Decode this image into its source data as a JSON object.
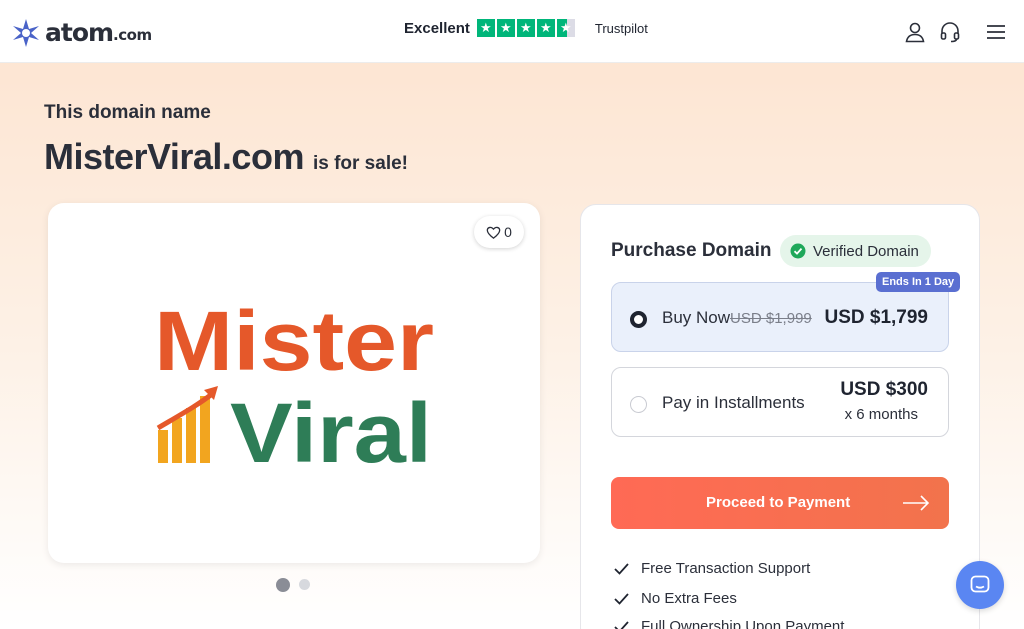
{
  "header": {
    "brand": "atom",
    "brand_tld": ".com",
    "trust_label": "Excellent",
    "trust_brand": "Trustpilot",
    "rating_stars": 4.5,
    "icons": [
      "user-icon",
      "headset-icon",
      "menu-icon"
    ]
  },
  "hero": {
    "subtitle": "This domain name",
    "domain": "MisterViral.com",
    "for_sale": "is for sale!"
  },
  "gallery": {
    "like_count": "0",
    "logo_line1": "Mister",
    "logo_line2": "Viral",
    "active_slide": 1,
    "slide_count": 2
  },
  "purchase": {
    "title": "Purchase Domain",
    "verified": "Verified Domain",
    "badge": "Ends In 1 Day",
    "options": [
      {
        "label": "Buy Now",
        "old_price": "USD $1,999",
        "price": "USD $1,799",
        "selected": true
      },
      {
        "label": "Pay in Installments",
        "price": "USD $300",
        "sub": "x 6 months",
        "selected": false
      }
    ],
    "cta": "Proceed to Payment",
    "features": [
      "Free Transaction Support",
      "No Extra Fees",
      "Full Ownership Upon Payment"
    ]
  },
  "colors": {
    "accent": "#ff6a55",
    "trust_green": "#00b67a",
    "badge_blue": "#5a6fd1",
    "logo_orange": "#e5582a",
    "logo_green": "#2e7d57",
    "chat_blue": "#5a86f2"
  }
}
